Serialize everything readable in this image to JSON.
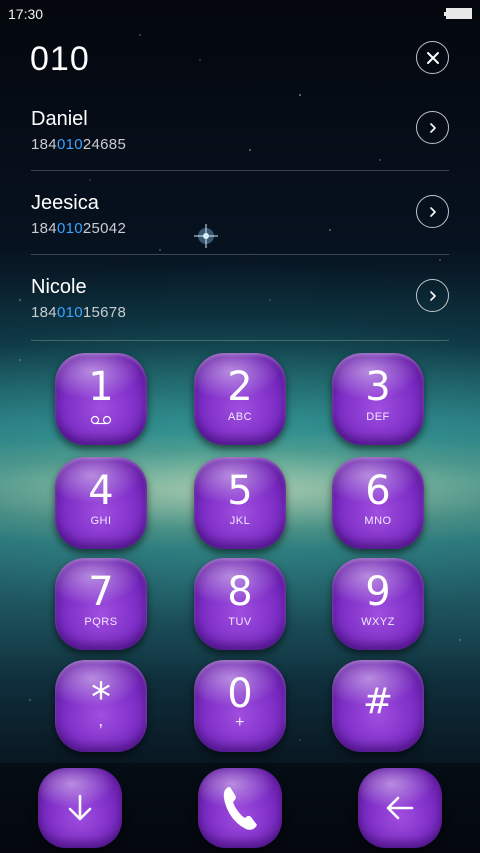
{
  "status_bar": {
    "time": "17:30"
  },
  "dialer": {
    "input": "010"
  },
  "contacts": [
    {
      "name": "Daniel",
      "phone_prefix": "184",
      "phone_match": "010",
      "phone_suffix": "24685"
    },
    {
      "name": "Jeesica",
      "phone_prefix": "184",
      "phone_match": "010",
      "phone_suffix": "25042"
    },
    {
      "name": "Nicole",
      "phone_prefix": "184",
      "phone_match": "010",
      "phone_suffix": "15678"
    }
  ],
  "keypad": [
    {
      "digit": "1",
      "letters": ""
    },
    {
      "digit": "2",
      "letters": "ABC"
    },
    {
      "digit": "3",
      "letters": "DEF"
    },
    {
      "digit": "4",
      "letters": "GHI"
    },
    {
      "digit": "5",
      "letters": "JKL"
    },
    {
      "digit": "6",
      "letters": "MNO"
    },
    {
      "digit": "7",
      "letters": "PQRS"
    },
    {
      "digit": "8",
      "letters": "TUV"
    },
    {
      "digit": "9",
      "letters": "WXYZ"
    },
    {
      "digit": "*",
      "letters": ","
    },
    {
      "digit": "0",
      "letters": "+"
    },
    {
      "digit": "#",
      "letters": ""
    }
  ],
  "icons": {
    "clear": "close-icon",
    "contact_open": "chevron-right-icon",
    "voicemail": "voicemail-icon",
    "collapse": "arrow-down-icon",
    "call": "phone-icon",
    "backspace": "arrow-left-icon"
  },
  "colors": {
    "match_highlight": "#3aa4ff",
    "key_purple": "#7b2cc4"
  }
}
